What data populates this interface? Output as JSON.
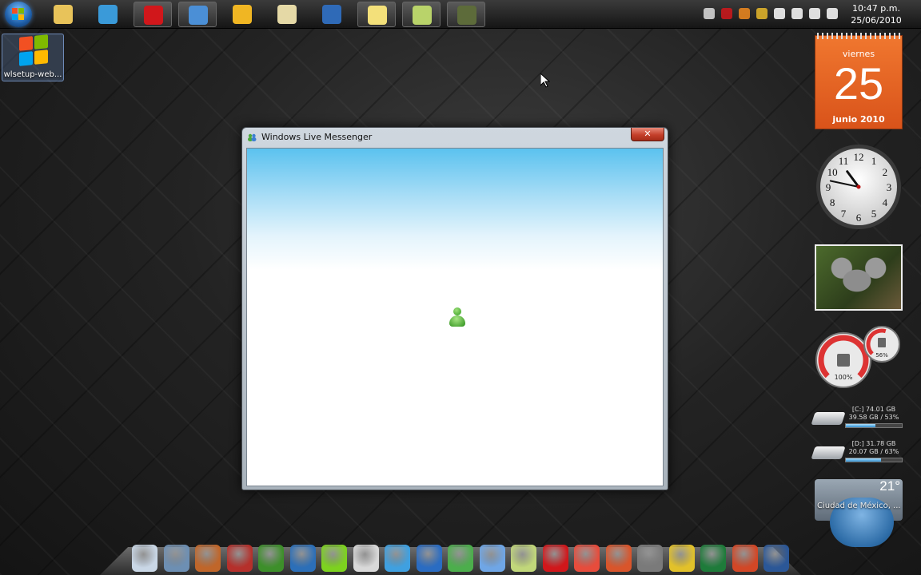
{
  "taskbar": {
    "start_icon": "windows-orb-icon",
    "pinned": [
      {
        "name": "explorer-taskbar-button",
        "icon": "folder-icon",
        "color": "#e8c35a",
        "active": false
      },
      {
        "name": "itunes-taskbar-button",
        "icon": "itunes-icon",
        "color": "#3a9ad9",
        "active": false
      },
      {
        "name": "opera-taskbar-button",
        "icon": "opera-icon",
        "color": "#d1171b",
        "active": true
      },
      {
        "name": "messenger-taskbar-button",
        "icon": "messenger-icon",
        "color": "#4b8fd6",
        "active": true
      },
      {
        "name": "daemon-tools-taskbar-button",
        "icon": "daemon-tools-icon",
        "color": "#f0b623",
        "active": false
      },
      {
        "name": "fireworks-taskbar-button",
        "icon": "fireworks-icon",
        "color": "#e5d9a6",
        "active": false
      },
      {
        "name": "photoshop-taskbar-button",
        "icon": "photoshop-icon",
        "color": "#2f6ab7",
        "active": false
      },
      {
        "name": "notes-taskbar-button",
        "icon": "sticky-notes-icon",
        "color": "#f3e07a",
        "active": true
      },
      {
        "name": "notes2-taskbar-button",
        "icon": "notes-icon",
        "color": "#b9d36a",
        "active": true
      },
      {
        "name": "camera-taskbar-button",
        "icon": "camcorder-icon",
        "color": "#5d6b3a",
        "active": true
      }
    ],
    "tray_icons": [
      {
        "name": "show-hidden-icons-icon",
        "color": "#dddddd"
      },
      {
        "name": "opera-tray-icon",
        "color": "#d1171b"
      },
      {
        "name": "update-tray-icon",
        "color": "#f08a1e"
      },
      {
        "name": "gadget-tray-icon",
        "color": "#e8b82a"
      },
      {
        "name": "action-center-flag-icon",
        "color": "#ffffff"
      },
      {
        "name": "network-signal-icon",
        "color": "#ffffff"
      },
      {
        "name": "battery-icon",
        "color": "#ffffff"
      },
      {
        "name": "volume-icon",
        "color": "#ffffff"
      }
    ],
    "clock": {
      "time": "10:47 p.m.",
      "date": "25/06/2010"
    }
  },
  "desktop": {
    "icon_label": "wlsetup-web..."
  },
  "window": {
    "title": "Windows Live Messenger",
    "close_label": "✕"
  },
  "gadgets": {
    "calendar": {
      "weekday": "viernes",
      "day": "25",
      "month_year": "junio 2010"
    },
    "clock": {
      "hours": 10,
      "minutes": 47,
      "numerals": [
        "12",
        "1",
        "2",
        "3",
        "4",
        "5",
        "6",
        "7",
        "8",
        "9",
        "10",
        "11"
      ]
    },
    "meter": {
      "cpu_label": "100%",
      "memory_label": "56%",
      "cpu_fraction": 1.0,
      "memory_fraction": 0.56
    },
    "drives": [
      {
        "title": "[C:] 74.01 GB",
        "usage": "39.58 GB / 53%",
        "fraction": 0.53
      },
      {
        "title": "[D:] 31.78 GB",
        "usage": "20.07 GB / 63%",
        "fraction": 0.63
      }
    ],
    "weather": {
      "temp": "21°",
      "city": "Ciudad de México, ..."
    }
  },
  "dock": {
    "icons": [
      {
        "name": "mail-dock-icon",
        "color": "#c9d7e6"
      },
      {
        "name": "media-player-dock-icon",
        "color": "#6d8fb3"
      },
      {
        "name": "movie-maker-dock-icon",
        "color": "#c0662a"
      },
      {
        "name": "books-dock-icon",
        "color": "#b5302b"
      },
      {
        "name": "utorrent-dock-icon",
        "color": "#3d8f2a"
      },
      {
        "name": "xbmc-dock-icon",
        "color": "#2c6fb8"
      },
      {
        "name": "xbox-dock-icon",
        "color": "#7dd21f"
      },
      {
        "name": "satellite-dock-icon",
        "color": "#d9d9d9"
      },
      {
        "name": "windows-dock-icon",
        "color": "#3fa0e0"
      },
      {
        "name": "globe-dock-icon",
        "color": "#2a6cc2"
      },
      {
        "name": "downloads-dock-icon",
        "color": "#4cae4c"
      },
      {
        "name": "messenger-dock-icon",
        "color": "#6fa6e6"
      },
      {
        "name": "notes-dock-icon",
        "color": "#c1d77a"
      },
      {
        "name": "opera-dock-icon",
        "color": "#d1171b"
      },
      {
        "name": "stickies-dock-icon",
        "color": "#e74c3c"
      },
      {
        "name": "tools-dock-icon",
        "color": "#d9552b"
      },
      {
        "name": "safari-dock-icon",
        "color": "#7a7a7a"
      },
      {
        "name": "norton-dock-icon",
        "color": "#e2c12a"
      },
      {
        "name": "excel-dock-icon",
        "color": "#1e7b3a"
      },
      {
        "name": "powerpoint-dock-icon",
        "color": "#d24726"
      },
      {
        "name": "word-dock-icon",
        "color": "#2b5797"
      }
    ]
  }
}
